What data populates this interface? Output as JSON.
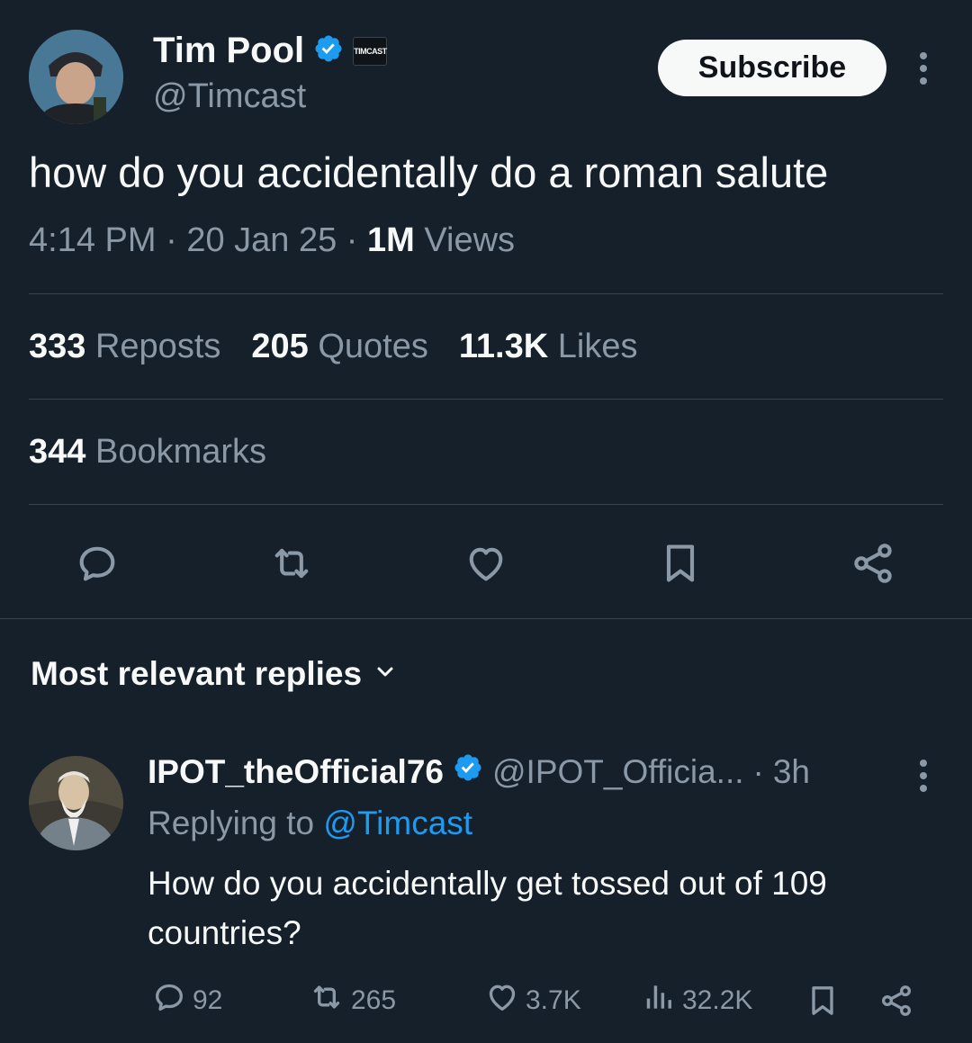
{
  "tweet": {
    "author_name": "Tim Pool",
    "author_handle": "@Timcast",
    "affiliate_badge": "TIMCAST",
    "subscribe_label": "Subscribe",
    "text": "how do you accidentally do a roman salute",
    "time": "4:14 PM",
    "date": "20 Jan 25",
    "views_count": "1M",
    "views_label": "Views",
    "reposts_count": "333",
    "reposts_label": "Reposts",
    "quotes_count": "205",
    "quotes_label": "Quotes",
    "likes_count": "11.3K",
    "likes_label": "Likes",
    "bookmarks_count": "344",
    "bookmarks_label": "Bookmarks"
  },
  "replies_header": "Most relevant replies",
  "reply": {
    "author_name": "IPOT_theOfficial76",
    "author_handle": "@IPOT_Officia...",
    "age": "3h",
    "replying_to_label": "Replying to",
    "replying_to_handle": "@Timcast",
    "text": "How do you accidentally get tossed out of 109 countries?",
    "reply_count": "92",
    "repost_count": "265",
    "like_count": "3.7K",
    "view_count": "32.2K"
  },
  "colors": {
    "background": "#15202b",
    "accent": "#1d9bf0",
    "muted": "#8b98a5",
    "divider": "#38444d"
  }
}
